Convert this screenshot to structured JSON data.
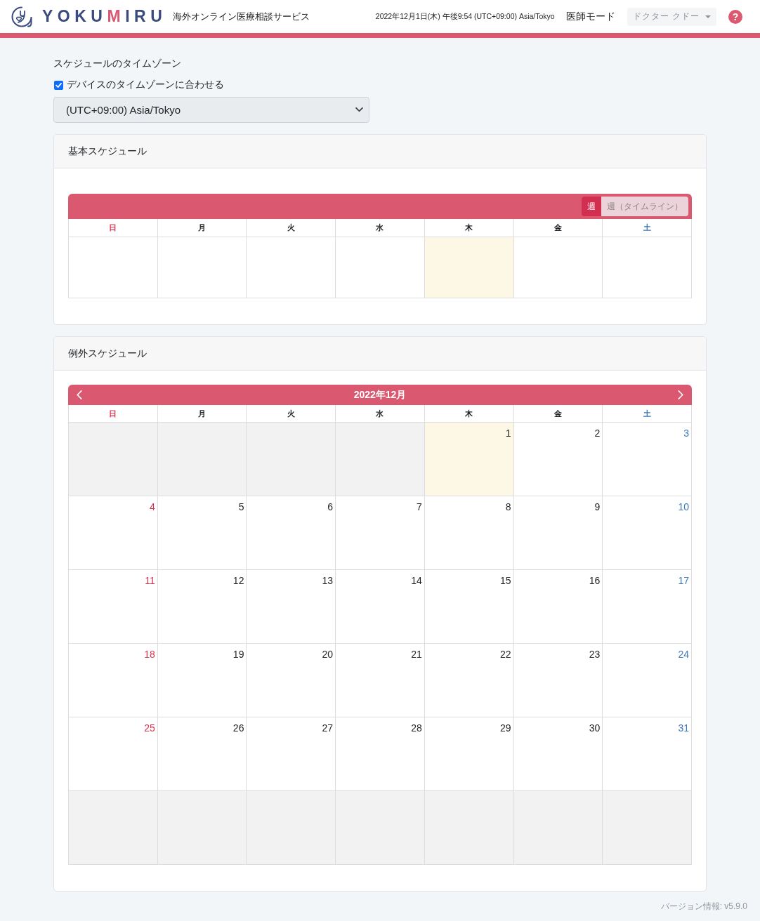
{
  "header": {
    "logo": {
      "parts": [
        {
          "text": "YOKU",
          "accent": false
        },
        {
          "text": "M",
          "accent": true
        },
        {
          "text": "IRU",
          "accent": false
        }
      ]
    },
    "tagline": "海外オンライン医療相談サービス",
    "datetime": "2022年12月1日(木) 午後9:54 (UTC+09:00) Asia/Tokyo",
    "mode": "医師モード",
    "user_menu": {
      "label": "ドクター クドー"
    },
    "help": {
      "label": "?"
    }
  },
  "timezone": {
    "title": "スケジュールのタイムゾーン",
    "match_device": {
      "label": "デバイスのタイムゾーンに合わせる",
      "checked": true
    },
    "select": {
      "value": "(UTC+09:00) Asia/Tokyo",
      "disabled": true
    }
  },
  "basic_schedule": {
    "title": "基本スケジュール",
    "views": [
      {
        "label": "週",
        "selected": true
      },
      {
        "label": "週（タイムライン）",
        "selected": false
      }
    ],
    "weekdays": [
      {
        "label": "日",
        "kind": "sunday"
      },
      {
        "label": "月",
        "kind": "weekday"
      },
      {
        "label": "火",
        "kind": "weekday"
      },
      {
        "label": "水",
        "kind": "weekday"
      },
      {
        "label": "木",
        "kind": "weekday"
      },
      {
        "label": "金",
        "kind": "weekday"
      },
      {
        "label": "土",
        "kind": "saturday"
      }
    ],
    "slots": [
      {
        "today": false
      },
      {
        "today": false
      },
      {
        "today": false
      },
      {
        "today": false
      },
      {
        "today": true
      },
      {
        "today": false
      },
      {
        "today": false
      }
    ]
  },
  "exception_schedule": {
    "title": "例外スケジュール",
    "month": "2022年12月",
    "weekdays": [
      {
        "label": "日",
        "kind": "sunday"
      },
      {
        "label": "月",
        "kind": "weekday"
      },
      {
        "label": "火",
        "kind": "weekday"
      },
      {
        "label": "水",
        "kind": "weekday"
      },
      {
        "label": "木",
        "kind": "weekday"
      },
      {
        "label": "金",
        "kind": "weekday"
      },
      {
        "label": "土",
        "kind": "saturday"
      }
    ],
    "weeks": [
      {
        "days": [
          {
            "today": false,
            "other_month": true
          },
          {
            "today": false,
            "other_month": true
          },
          {
            "today": false,
            "other_month": true
          },
          {
            "today": false,
            "other_month": true
          },
          {
            "day": "1",
            "today": true,
            "other_month": false
          },
          {
            "day": "2",
            "today": false,
            "other_month": false
          },
          {
            "day": "3",
            "today": false,
            "other_month": false
          }
        ]
      },
      {
        "days": [
          {
            "day": "4",
            "today": false,
            "other_month": false
          },
          {
            "day": "5",
            "today": false,
            "other_month": false
          },
          {
            "day": "6",
            "today": false,
            "other_month": false
          },
          {
            "day": "7",
            "today": false,
            "other_month": false
          },
          {
            "day": "8",
            "today": false,
            "other_month": false
          },
          {
            "day": "9",
            "today": false,
            "other_month": false
          },
          {
            "day": "10",
            "today": false,
            "other_month": false
          }
        ]
      },
      {
        "days": [
          {
            "day": "11",
            "today": false,
            "other_month": false
          },
          {
            "day": "12",
            "today": false,
            "other_month": false
          },
          {
            "day": "13",
            "today": false,
            "other_month": false
          },
          {
            "day": "14",
            "today": false,
            "other_month": false
          },
          {
            "day": "15",
            "today": false,
            "other_month": false
          },
          {
            "day": "16",
            "today": false,
            "other_month": false
          },
          {
            "day": "17",
            "today": false,
            "other_month": false
          }
        ]
      },
      {
        "days": [
          {
            "day": "18",
            "today": false,
            "other_month": false
          },
          {
            "day": "19",
            "today": false,
            "other_month": false
          },
          {
            "day": "20",
            "today": false,
            "other_month": false
          },
          {
            "day": "21",
            "today": false,
            "other_month": false
          },
          {
            "day": "22",
            "today": false,
            "other_month": false
          },
          {
            "day": "23",
            "today": false,
            "other_month": false
          },
          {
            "day": "24",
            "today": false,
            "other_month": false
          }
        ]
      },
      {
        "days": [
          {
            "day": "25",
            "today": false,
            "other_month": false
          },
          {
            "day": "26",
            "today": false,
            "other_month": false
          },
          {
            "day": "27",
            "today": false,
            "other_month": false
          },
          {
            "day": "28",
            "today": false,
            "other_month": false
          },
          {
            "day": "29",
            "today": false,
            "other_month": false
          },
          {
            "day": "30",
            "today": false,
            "other_month": false
          },
          {
            "day": "31",
            "today": false,
            "other_month": false
          }
        ]
      },
      {
        "days": [
          {
            "today": false,
            "other_month": true
          },
          {
            "today": false,
            "other_month": true
          },
          {
            "today": false,
            "other_month": true
          },
          {
            "today": false,
            "other_month": true
          },
          {
            "today": false,
            "other_month": true
          },
          {
            "today": false,
            "other_month": true
          },
          {
            "today": false,
            "other_month": true
          }
        ]
      }
    ]
  },
  "footer": {
    "version": "バージョン情報: v5.9.0"
  }
}
